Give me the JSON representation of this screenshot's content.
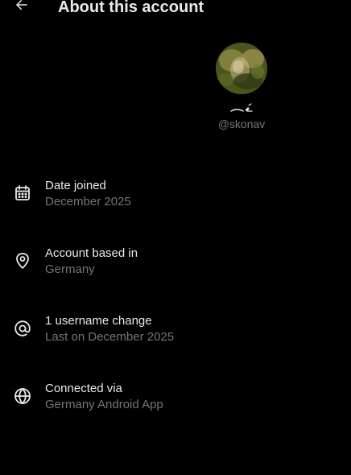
{
  "header": {
    "title": "About this account",
    "back_icon": "arrow-left-icon"
  },
  "profile": {
    "display_name": "⁔✍",
    "handle": "@skonav"
  },
  "items": [
    {
      "icon": "calendar-icon",
      "title": "Date joined",
      "value": "December 2025"
    },
    {
      "icon": "location-pin-icon",
      "title": "Account based in",
      "value": "Germany"
    },
    {
      "icon": "at-sign-icon",
      "title": "1 username change",
      "value": "Last on December 2025"
    },
    {
      "icon": "globe-icon",
      "title": "Connected via",
      "value": "Germany Android App"
    }
  ],
  "colors": {
    "background": "#000000",
    "primary_text": "#e7e9ea",
    "secondary_text": "#71767b"
  }
}
